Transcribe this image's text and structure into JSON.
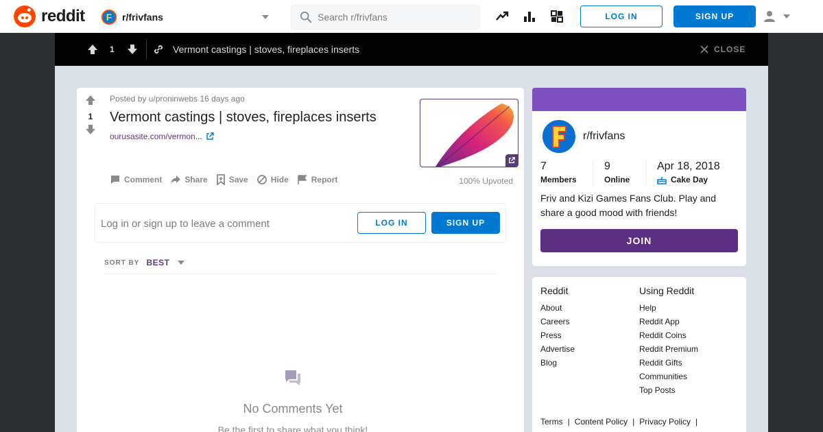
{
  "header": {
    "logo_text": "reddit",
    "community": "r/frivfans",
    "community_icon_letter": "F",
    "search_placeholder": "Search r/frivfans",
    "login_label": "LOG IN",
    "signup_label": "SIGN UP"
  },
  "postbar": {
    "score": "1",
    "title": "Vermont castings | stoves, fireplaces inserts",
    "close_label": "CLOSE"
  },
  "post": {
    "score": "1",
    "posted_by": "Posted by u/proninwebs 16 days ago",
    "title": "Vermont castings | stoves, fireplaces inserts",
    "link": "ourusasite.com/vermon...",
    "actions": {
      "comment": "Comment",
      "share": "Share",
      "save": "Save",
      "hide": "Hide",
      "report": "Report"
    },
    "upvoted": "100% Upvoted"
  },
  "comment_box": {
    "prompt": "Log in or sign up to leave a comment",
    "login_label": "LOG IN",
    "signup_label": "SIGN UP"
  },
  "sort": {
    "label": "SORT BY",
    "value": "BEST"
  },
  "empty": {
    "title": "No Comments Yet",
    "subtitle": "Be the first to share what you think!"
  },
  "sidebar": {
    "name": "r/frivfans",
    "avatar_letter": "F",
    "members_count": "7",
    "members_label": "Members",
    "online_count": "9",
    "online_label": "Online",
    "cake_date": "Apr 18, 2018",
    "cake_label": "Cake Day",
    "description": "Friv and Kizi Games Fans Club. Play and share a good mood with friends!",
    "join_label": "JOIN"
  },
  "footer": {
    "col1_title": "Reddit",
    "col1_links": [
      "About",
      "Careers",
      "Press",
      "Advertise",
      "Blog"
    ],
    "col2_title": "Using Reddit",
    "col2_links": [
      "Help",
      "Reddit App",
      "Reddit Coins",
      "Reddit Premium",
      "Reddit Gifts",
      "Communities",
      "Top Posts"
    ],
    "legal": [
      "Terms",
      "Content Policy",
      "Privacy Policy"
    ]
  },
  "colors": {
    "brand": "#ff4500",
    "blue": "#0079d3",
    "purple_banner": "#7e53c1",
    "join": "#5a2f82",
    "background": "#dae0e6"
  }
}
